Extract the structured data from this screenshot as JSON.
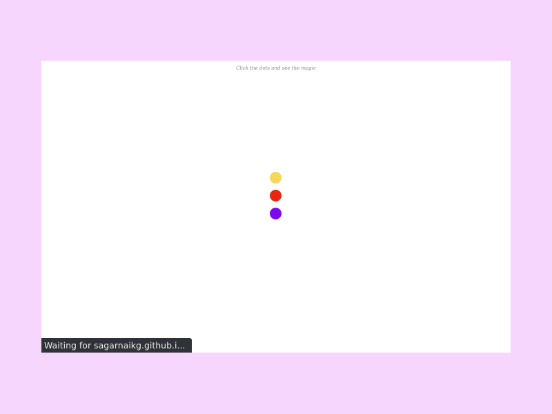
{
  "page": {
    "instruction": "Click the dots and see the magic"
  },
  "dots": [
    {
      "name": "yellow",
      "color": "#f6d75a"
    },
    {
      "name": "red",
      "color": "#e8260f"
    },
    {
      "name": "purple",
      "color": "#7d08f0"
    }
  ],
  "status_bar": {
    "text": "Waiting for sagarnaikg.github.i..."
  }
}
